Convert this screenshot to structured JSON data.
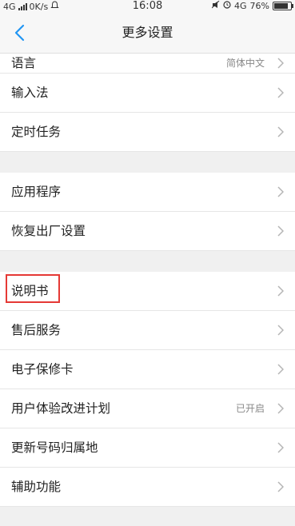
{
  "status_bar": {
    "network": "4G",
    "speed": "0K/s",
    "time": "16:08",
    "network_right": "4G",
    "battery": "76%"
  },
  "nav": {
    "title": "更多设置"
  },
  "groups": [
    {
      "items": [
        {
          "label": "语言",
          "value": "简体中文"
        },
        {
          "label": "输入法",
          "value": ""
        },
        {
          "label": "定时任务",
          "value": ""
        }
      ]
    },
    {
      "items": [
        {
          "label": "应用程序",
          "value": ""
        },
        {
          "label": "恢复出厂设置",
          "value": ""
        }
      ]
    },
    {
      "items": [
        {
          "label": "说明书",
          "value": "",
          "highlighted": true
        },
        {
          "label": "售后服务",
          "value": ""
        },
        {
          "label": "电子保修卡",
          "value": ""
        },
        {
          "label": "用户体验改进计划",
          "value": "已开启"
        },
        {
          "label": "更新号码归属地",
          "value": ""
        },
        {
          "label": "辅助功能",
          "value": ""
        }
      ]
    }
  ],
  "colors": {
    "accent": "#2196f3",
    "highlight_box": "#e53935"
  },
  "icons": {
    "back": "back-chevron-icon",
    "row": "chevron-right-icon"
  }
}
